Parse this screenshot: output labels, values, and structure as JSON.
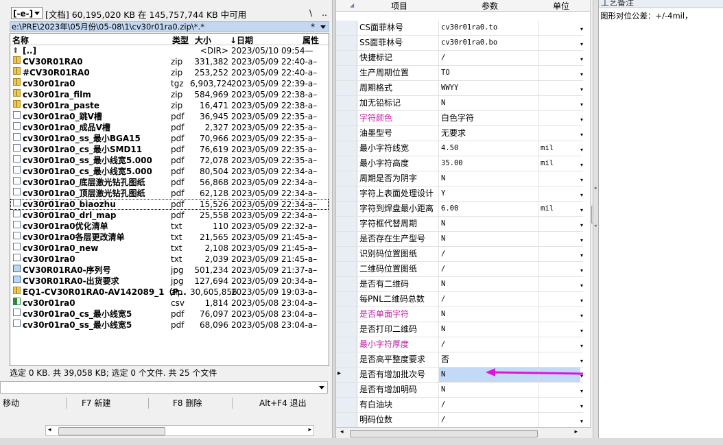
{
  "left": {
    "drive": "[-e-]",
    "drive_info": "[文档]  60,195,020 KB 在 145,757,744 KB 中可用",
    "btn_backslash": "\\",
    "btn_dotdot": "..",
    "path": "e:\\PRE\\2023年\\05月份\\05-08\\1\\cv30r01ra0.zip\\*.*",
    "path_filter": "*",
    "columns": {
      "name": "名称",
      "type": "类型",
      "size": "大小",
      "date": "↓日期",
      "attr": "属性"
    },
    "files": [
      {
        "name": "[..]",
        "type": "",
        "size": "<DIR>",
        "date": "2023/05/10 09:54—",
        "icon": "up"
      },
      {
        "name": "CV30R01RA0",
        "type": "zip",
        "size": "331,382",
        "date": "2023/05/09 22:40-a–",
        "icon": "zip"
      },
      {
        "name": "#CV30R01RA0",
        "type": "zip",
        "size": "253,252",
        "date": "2023/05/09 22:40-a–",
        "icon": "zip"
      },
      {
        "name": "cv30r01ra0",
        "type": "tgz",
        "size": "6,903,724",
        "date": "2023/05/09 22:39-a–",
        "icon": "zip"
      },
      {
        "name": "cv30r01ra_film",
        "type": "zip",
        "size": "584,969",
        "date": "2023/05/09 22:38-a–",
        "icon": "zip"
      },
      {
        "name": "cv30r01ra_paste",
        "type": "zip",
        "size": "16,471",
        "date": "2023/05/09 22:38-a–",
        "icon": "zip"
      },
      {
        "name": "cv30r01ra0_跳V槽",
        "type": "pdf",
        "size": "36,945",
        "date": "2023/05/09 22:35-a–",
        "icon": "doc"
      },
      {
        "name": "cv30r01ra0_成品V槽",
        "type": "pdf",
        "size": "2,327",
        "date": "2023/05/09 22:35-a–",
        "icon": "doc"
      },
      {
        "name": "cv30r01ra0_ss_最小BGA15",
        "type": "pdf",
        "size": "70,966",
        "date": "2023/05/09 22:35-a–",
        "icon": "doc"
      },
      {
        "name": "cv30r01ra0_cs_最小SMD11",
        "type": "pdf",
        "size": "76,619",
        "date": "2023/05/09 22:35-a–",
        "icon": "doc"
      },
      {
        "name": "cv30r01ra0_ss_最小线宽5.000",
        "type": "pdf",
        "size": "72,078",
        "date": "2023/05/09 22:35-a–",
        "icon": "doc"
      },
      {
        "name": "cv30r01ra0_cs_最小线宽5.000",
        "type": "pdf",
        "size": "80,504",
        "date": "2023/05/09 22:34-a–",
        "icon": "doc"
      },
      {
        "name": "cv30r01ra0_底层激光钻孔图纸",
        "type": "pdf",
        "size": "56,868",
        "date": "2023/05/09 22:34-a–",
        "icon": "doc"
      },
      {
        "name": "cv30r01ra0_顶层激光钻孔图纸",
        "type": "pdf",
        "size": "62,128",
        "date": "2023/05/09 22:34-a–",
        "icon": "doc"
      },
      {
        "name": "cv30r01ra0_biaozhu",
        "type": "pdf",
        "size": "15,526",
        "date": "2023/05/09 22:34-a–",
        "icon": "doc",
        "selected": true
      },
      {
        "name": "cv30r01ra0_drl_map",
        "type": "pdf",
        "size": "25,558",
        "date": "2023/05/09 22:34-a–",
        "icon": "doc"
      },
      {
        "name": "cv30r01ra0优化清单",
        "type": "txt",
        "size": "110",
        "date": "2023/05/09 22:32-a–",
        "icon": "doc"
      },
      {
        "name": "cv30r01ra0各层更改清单",
        "type": "txt",
        "size": "21,565",
        "date": "2023/05/09 21:45-a–",
        "icon": "doc"
      },
      {
        "name": "cv30r01ra0_new",
        "type": "txt",
        "size": "2,108",
        "date": "2023/05/09 21:45-a–",
        "icon": "doc"
      },
      {
        "name": "cv30r01ra0",
        "type": "txt",
        "size": "2,039",
        "date": "2023/05/09 21:45-a–",
        "icon": "doc"
      },
      {
        "name": "CV30R01RA0-序列号",
        "type": "jpg",
        "size": "501,234",
        "date": "2023/05/09 21:37-a–",
        "icon": "img"
      },
      {
        "name": "CV30R01RA0-出货要求",
        "type": "jpg",
        "size": "127,694",
        "date": "2023/05/09 20:34-a–",
        "icon": "img"
      },
      {
        "name": "EQ1-CV30R01RA0-AV142089_1（P...",
        "type": "zip",
        "size": "30,605,856",
        "date": "2023/05/09 19:03-a–",
        "icon": "zip"
      },
      {
        "name": "cv30r01ra0",
        "type": "csv",
        "size": "1,814",
        "date": "2023/05/08 23:04-a–",
        "icon": "csv"
      },
      {
        "name": "cv30r01ra0_cs_最小线宽5",
        "type": "pdf",
        "size": "76,097",
        "date": "2023/05/08 23:04-a–",
        "icon": "doc"
      },
      {
        "name": "cv30r01ra0_ss_最小线宽5",
        "type": "pdf",
        "size": "68,096",
        "date": "2023/05/08 23:04-a–",
        "icon": "doc"
      }
    ],
    "status": "选定 0 KB. 共 39,058 KB; 选定 0 个文件. 共 25 个文件",
    "fkeys": {
      "move": "移动",
      "new": "F7 新建",
      "del": "F8 删除",
      "exit": "Alt+F4 退出"
    }
  },
  "grid": {
    "headers": {
      "name": "项目",
      "value": "参数",
      "unit": "单位"
    },
    "rows": [
      {
        "name": "CS面菲林号",
        "value": "cv30r01ra0.to",
        "unit": "",
        "color": ""
      },
      {
        "name": "SS面菲林号",
        "value": "cv30r01ra0.bo",
        "unit": "",
        "color": ""
      },
      {
        "name": "快捷标记",
        "value": "/",
        "unit": "",
        "color": ""
      },
      {
        "name": "生产周期位置",
        "value": "TO",
        "unit": "",
        "color": ""
      },
      {
        "name": "周期格式",
        "value": "WWYY",
        "unit": "",
        "color": ""
      },
      {
        "name": "加无铅标记",
        "value": "N",
        "unit": "",
        "color": ""
      },
      {
        "name": "字符颜色",
        "value": "白色字符",
        "unit": "",
        "color": "pink"
      },
      {
        "name": "油墨型号",
        "value": "无要求",
        "unit": "",
        "color": ""
      },
      {
        "name": "最小字符线宽",
        "value": "4.50",
        "unit": "mil",
        "color": ""
      },
      {
        "name": "最小字符高度",
        "value": "35.00",
        "unit": "mil",
        "color": ""
      },
      {
        "name": "周期是否为阴字",
        "value": "N",
        "unit": "",
        "color": ""
      },
      {
        "name": "字符上表面处理设计",
        "value": "Y",
        "unit": "",
        "color": ""
      },
      {
        "name": "字符到焊盘最小距离",
        "value": "6.00",
        "unit": "mil",
        "color": ""
      },
      {
        "name": "字符框代替周期",
        "value": "N",
        "unit": "",
        "color": ""
      },
      {
        "name": "是否存在生产型号",
        "value": "N",
        "unit": "",
        "color": ""
      },
      {
        "name": "识别码位置图纸",
        "value": "/",
        "unit": "",
        "color": ""
      },
      {
        "name": "二维码位置图纸",
        "value": "/",
        "unit": "",
        "color": ""
      },
      {
        "name": "是否有二维码",
        "value": "N",
        "unit": "",
        "color": ""
      },
      {
        "name": "每PNL二维码总数",
        "value": "/",
        "unit": "",
        "color": ""
      },
      {
        "name": "是否单面字符",
        "value": "N",
        "unit": "",
        "color": "pink"
      },
      {
        "name": "是否打印二维码",
        "value": "N",
        "unit": "",
        "color": ""
      },
      {
        "name": "最小字符厚度",
        "value": "/",
        "unit": "",
        "color": "pink"
      },
      {
        "name": "是否高平整度要求",
        "value": "否",
        "unit": "",
        "color": ""
      },
      {
        "name": "是否有增加批次号",
        "value": "N",
        "unit": "",
        "color": "",
        "current": true
      },
      {
        "name": "是否有增加明码",
        "value": "N",
        "unit": "",
        "color": ""
      },
      {
        "name": "有白油块",
        "value": "/",
        "unit": "",
        "color": ""
      },
      {
        "name": "明码位数",
        "value": "/",
        "unit": "",
        "color": ""
      }
    ],
    "arrow_color": "#e010e0"
  },
  "notes": {
    "title": "工艺备注",
    "text": "图形对位公差：+/-4mil，"
  }
}
